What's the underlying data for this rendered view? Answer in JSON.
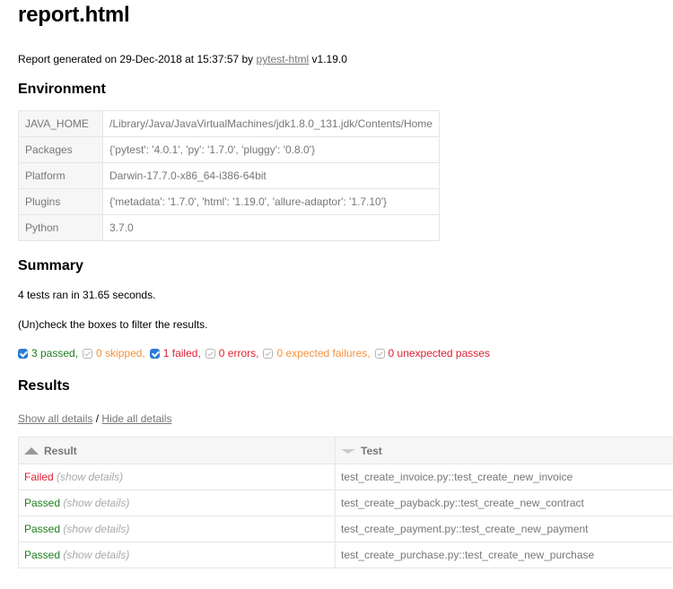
{
  "title": "report.html",
  "generated": {
    "prefix": "Report generated on 29-Dec-2018 at 15:37:57 by",
    "link": "pytest-html",
    "version": " v1.19.0"
  },
  "environment": {
    "heading": "Environment",
    "rows": [
      {
        "key": "JAVA_HOME",
        "value": "/Library/Java/JavaVirtualMachines/jdk1.8.0_131.jdk/Contents/Home"
      },
      {
        "key": "Packages",
        "value": "{'pytest': '4.0.1', 'py': '1.7.0', 'pluggy': '0.8.0'}"
      },
      {
        "key": "Platform",
        "value": "Darwin-17.7.0-x86_64-i386-64bit"
      },
      {
        "key": "Plugins",
        "value": "{'metadata': '1.7.0', 'html': '1.19.0', 'allure-adaptor': '1.7.10'}"
      },
      {
        "key": "Python",
        "value": "3.7.0"
      }
    ]
  },
  "summary": {
    "heading": "Summary",
    "tests_ran": "4 tests ran in 31.65 seconds.",
    "filter_hint": "(Un)check the boxes to filter the results.",
    "filters": [
      {
        "label": "3 passed,",
        "checked": true,
        "color": "#1d7f1d"
      },
      {
        "label": "0 skipped,",
        "checked": false,
        "color": "#f7913b"
      },
      {
        "label": "1 failed,",
        "checked": true,
        "color": "#e01e32"
      },
      {
        "label": "0 errors,",
        "checked": false,
        "color": "#e01e32"
      },
      {
        "label": "0 expected failures,",
        "checked": false,
        "color": "#f7913b"
      },
      {
        "label": "0 unexpected passes",
        "checked": false,
        "color": "#e01e32"
      }
    ]
  },
  "results": {
    "heading": "Results",
    "show_all": "Show all details",
    "separator": " / ",
    "hide_all": "Hide all details",
    "columns": {
      "result": "Result",
      "test": "Test"
    },
    "rows": [
      {
        "result": "Failed",
        "details": "(show details)",
        "test": "test_create_invoice.py::test_create_new_invoice"
      },
      {
        "result": "Passed",
        "details": "(show details)",
        "test": "test_create_payback.py::test_create_new_contract"
      },
      {
        "result": "Passed",
        "details": "(show details)",
        "test": "test_create_payment.py::test_create_new_payment"
      },
      {
        "result": "Passed",
        "details": "(show details)",
        "test": "test_create_purchase.py::test_create_new_purchase"
      }
    ]
  }
}
